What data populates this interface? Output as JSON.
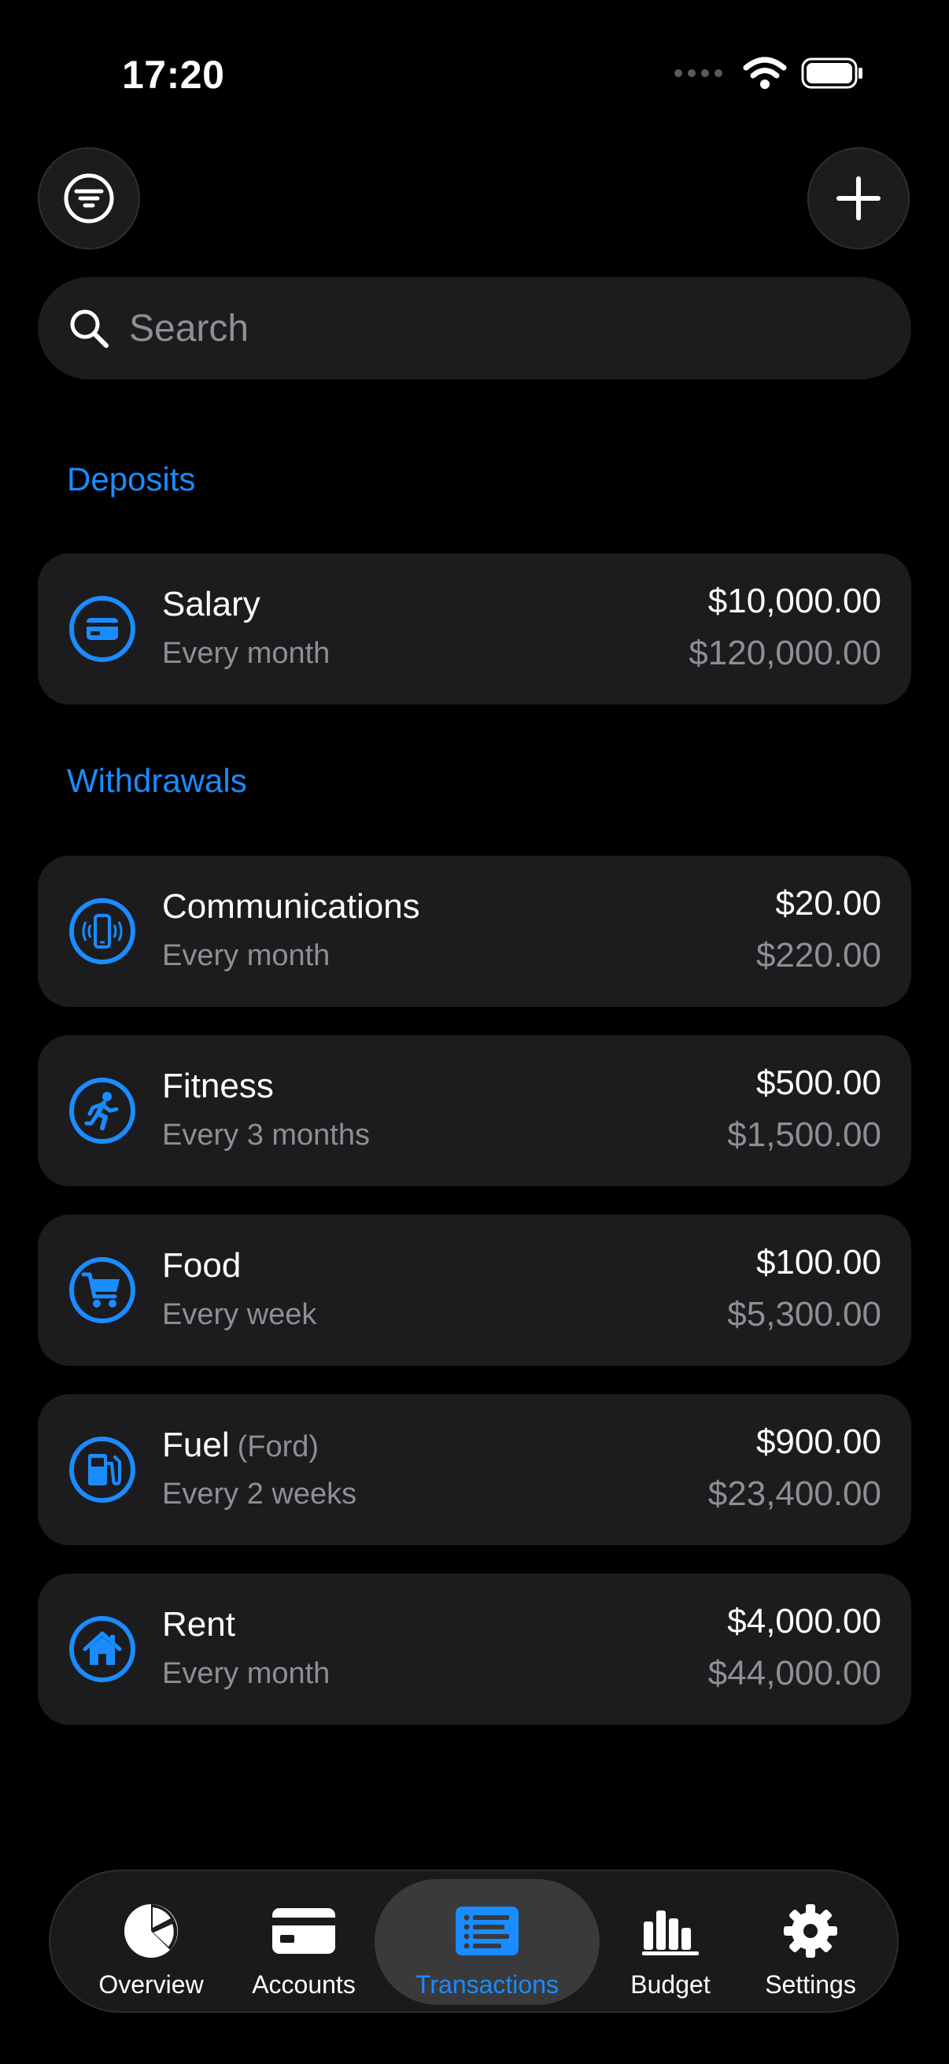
{
  "status_bar": {
    "time": "17:20"
  },
  "header": {
    "filter_icon": "filter-icon",
    "add_icon": "plus-icon"
  },
  "search": {
    "placeholder": "Search",
    "value": ""
  },
  "sections": {
    "deposits": "Deposits",
    "withdrawals": "Withdrawals"
  },
  "deposits": [
    {
      "title": "Salary",
      "subtitle": "",
      "frequency": "Every month",
      "amount": "$10,000.00",
      "total": "$120,000.00",
      "icon": "credit-card-icon"
    }
  ],
  "withdrawals": [
    {
      "title": "Communications",
      "subtitle": "",
      "frequency": "Every month",
      "amount": "$20.00",
      "total": "$220.00",
      "icon": "phone-icon"
    },
    {
      "title": "Fitness",
      "subtitle": "",
      "frequency": "Every 3 months",
      "amount": "$500.00",
      "total": "$1,500.00",
      "icon": "running-icon"
    },
    {
      "title": "Food",
      "subtitle": "",
      "frequency": "Every week",
      "amount": "$100.00",
      "total": "$5,300.00",
      "icon": "cart-icon"
    },
    {
      "title": "Fuel",
      "subtitle": "(Ford)",
      "frequency": "Every 2 weeks",
      "amount": "$900.00",
      "total": "$23,400.00",
      "icon": "fuel-pump-icon"
    },
    {
      "title": "Rent",
      "subtitle": "",
      "frequency": "Every month",
      "amount": "$4,000.00",
      "total": "$44,000.00",
      "icon": "house-icon"
    }
  ],
  "tabbar": {
    "items": [
      {
        "label": "Overview",
        "icon": "pie-chart-icon"
      },
      {
        "label": "Accounts",
        "icon": "card-icon"
      },
      {
        "label": "Transactions",
        "icon": "list-icon",
        "active": true
      },
      {
        "label": "Budget",
        "icon": "bar-chart-icon"
      },
      {
        "label": "Settings",
        "icon": "gear-icon"
      }
    ]
  },
  "colors": {
    "accent": "#1a8cff",
    "card": "#1c1c1e",
    "secondary_text": "#8e8e93",
    "background": "#000000"
  }
}
